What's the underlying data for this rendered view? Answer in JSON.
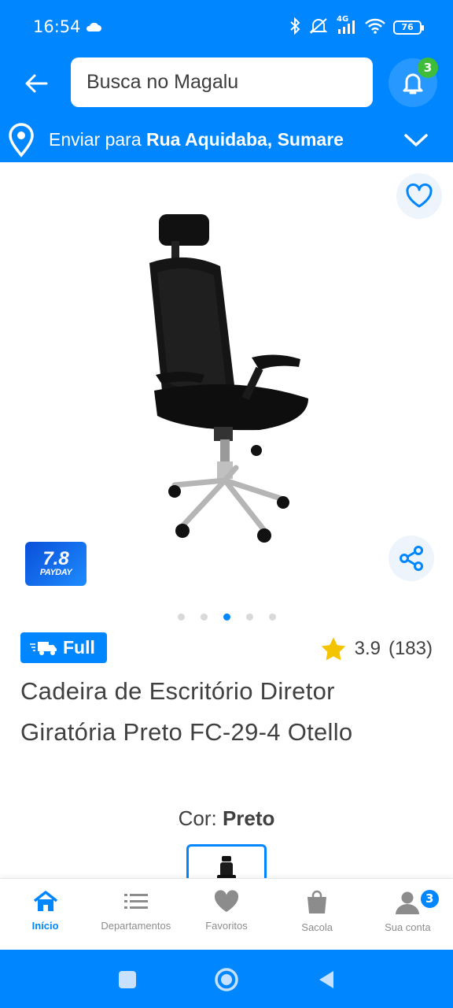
{
  "status": {
    "time": "16:54",
    "network": "4G",
    "battery": "76"
  },
  "header": {
    "search_placeholder": "Busca no Magalu",
    "notifications_count": "3",
    "address_prefix": "Enviar para ",
    "address": "Rua Aquidaba, Sumare"
  },
  "gallery": {
    "promo_badge_number": "7.8",
    "promo_badge_text": "PAYDAY",
    "dots_total": 5,
    "active_dot": 3
  },
  "product": {
    "shipping_tag": "Full",
    "rating": "3.9",
    "reviews": "(183)",
    "title": "Cadeira de Escritório Diretor Giratória Preto FC-29-4 Otello",
    "color_label": "Cor: ",
    "color_value": "Preto"
  },
  "bottom_nav": {
    "items": [
      {
        "label": "Início",
        "active": true
      },
      {
        "label": "Departamentos"
      },
      {
        "label": "Favoritos"
      },
      {
        "label": "Sacola"
      },
      {
        "label": "Sua conta",
        "badge": "3"
      }
    ]
  },
  "colors": {
    "brand_blue": "#0086ff",
    "badge_green": "#3fbd3a",
    "star_yellow": "#f5c400",
    "text": "#404040"
  }
}
